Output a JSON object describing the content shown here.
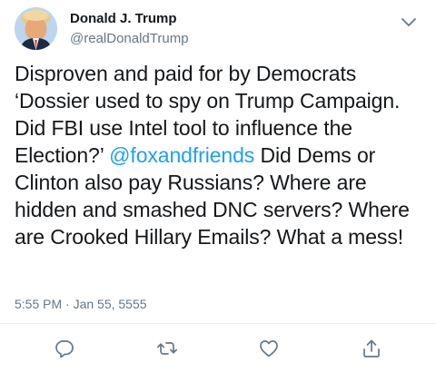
{
  "tweet": {
    "author_name": "Donald J. Trump",
    "author_handle": "@realDonaldTrump",
    "text_part1": "Disproven and paid for by Democrats ‘Dossier used to spy on Trump Campaign. Did FBI use Intel tool to influence the Election?’ ",
    "mention": "@foxandfriends",
    "text_part2": " Did Dems or Clinton also pay Russians? Where are hidden and smashed DNC servers? Where are Crooked Hillary Emails? What a mess!",
    "timestamp": "5:55 PM · Jan 55, 5555"
  },
  "icons": {
    "more": "chevron-down-icon",
    "reply": "speech-bubble-icon",
    "retweet": "retweet-arrows-icon",
    "like": "heart-icon",
    "share": "share-upload-icon"
  },
  "colors": {
    "text": "#14171a",
    "secondary": "#657786",
    "link": "#1da1f2",
    "divider": "#e6ecf0"
  }
}
